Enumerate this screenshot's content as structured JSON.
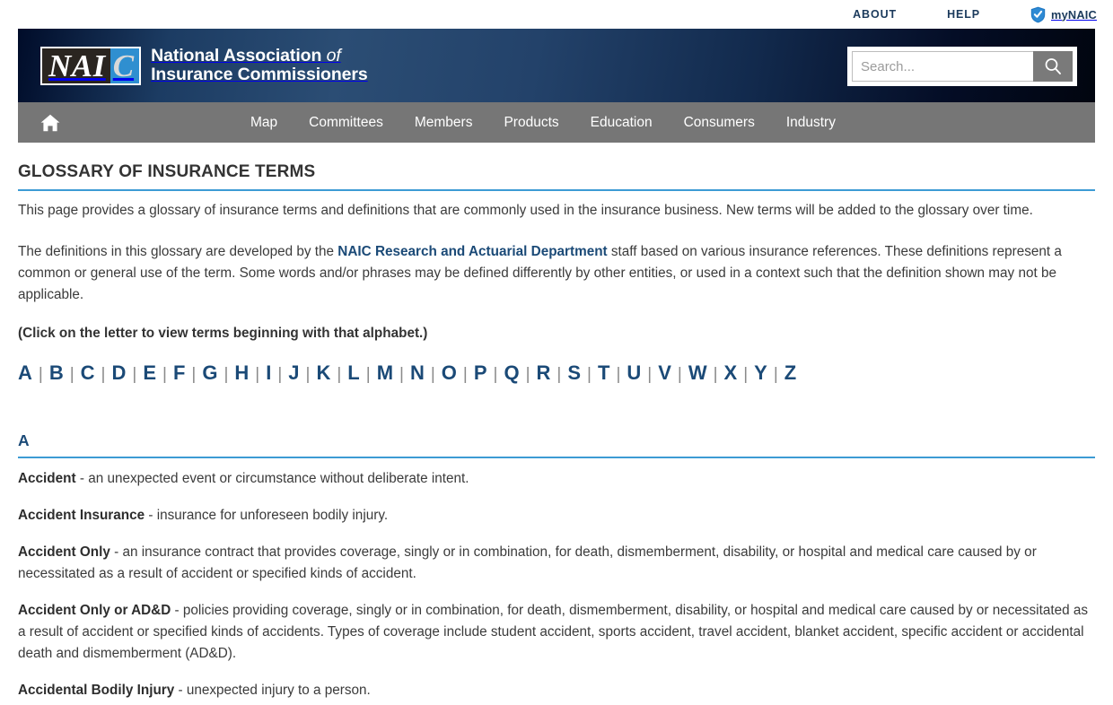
{
  "utility": {
    "about": "ABOUT",
    "help": "HELP",
    "mynaic": "myNAIC"
  },
  "masthead": {
    "logo_nai": "NAI",
    "logo_c": "C",
    "org_line1_main": "National Association ",
    "org_line1_of": "of",
    "org_line2": "Insurance Commissioners"
  },
  "search": {
    "placeholder": "Search...",
    "value": ""
  },
  "nav": {
    "home_label": "Home",
    "items": [
      {
        "label": "Map"
      },
      {
        "label": "Committees"
      },
      {
        "label": "Members"
      },
      {
        "label": "Products"
      },
      {
        "label": "Education"
      },
      {
        "label": "Consumers"
      },
      {
        "label": "Industry"
      }
    ]
  },
  "page": {
    "title": "GLOSSARY OF INSURANCE TERMS",
    "intro1": "This page provides a glossary of insurance terms and definitions that are commonly used in the insurance business. New terms will be added to the glossary over time.",
    "intro2_before": "The definitions in this glossary are developed by the ",
    "intro2_link": "NAIC Research and Actuarial Department",
    "intro2_after": " staff based on various insurance references. These definitions represent a common or general use of the term. Some words and/or phrases may be defined differently by other entities, or used in a context such that the definition shown may not be applicable.",
    "click_note": "(Click on the letter to view terms beginning with that alphabet.)",
    "alphabet": [
      "A",
      "B",
      "C",
      "D",
      "E",
      "F",
      "G",
      "H",
      "I",
      "J",
      "K",
      "L",
      "M",
      "N",
      "O",
      "P",
      "Q",
      "R",
      "S",
      "T",
      "U",
      "V",
      "W",
      "X",
      "Y",
      "Z"
    ],
    "separator": "|",
    "section_letter": "A",
    "entries": [
      {
        "term": "Accident",
        "definition": " - an unexpected event or circumstance without deliberate intent."
      },
      {
        "term": "Accident Insurance",
        "definition": " - insurance for unforeseen bodily injury."
      },
      {
        "term": "Accident Only",
        "definition": " - an insurance contract that provides coverage, singly or in combination, for death, dismemberment, disability, or hospital and medical care caused by or necessitated as a result of accident or specified kinds of accident."
      },
      {
        "term": "Accident Only or AD&D",
        "definition": " - policies providing coverage, singly or in combination, for death, dismemberment, disability, or hospital and medical care caused by or necessitated as a result of accident or specified kinds of accidents. Types of coverage include student accident, sports accident, travel accident, blanket accident, specific accident or accidental death and dismemberment (AD&D)."
      },
      {
        "term": "Accidental Bodily Injury",
        "definition": " - unexpected injury to a person."
      }
    ]
  },
  "colors": {
    "accent_blue": "#3c9bd4",
    "link_navy": "#1b4a77",
    "nav_gray": "#767676",
    "logo_blue": "#2f8fd0"
  }
}
